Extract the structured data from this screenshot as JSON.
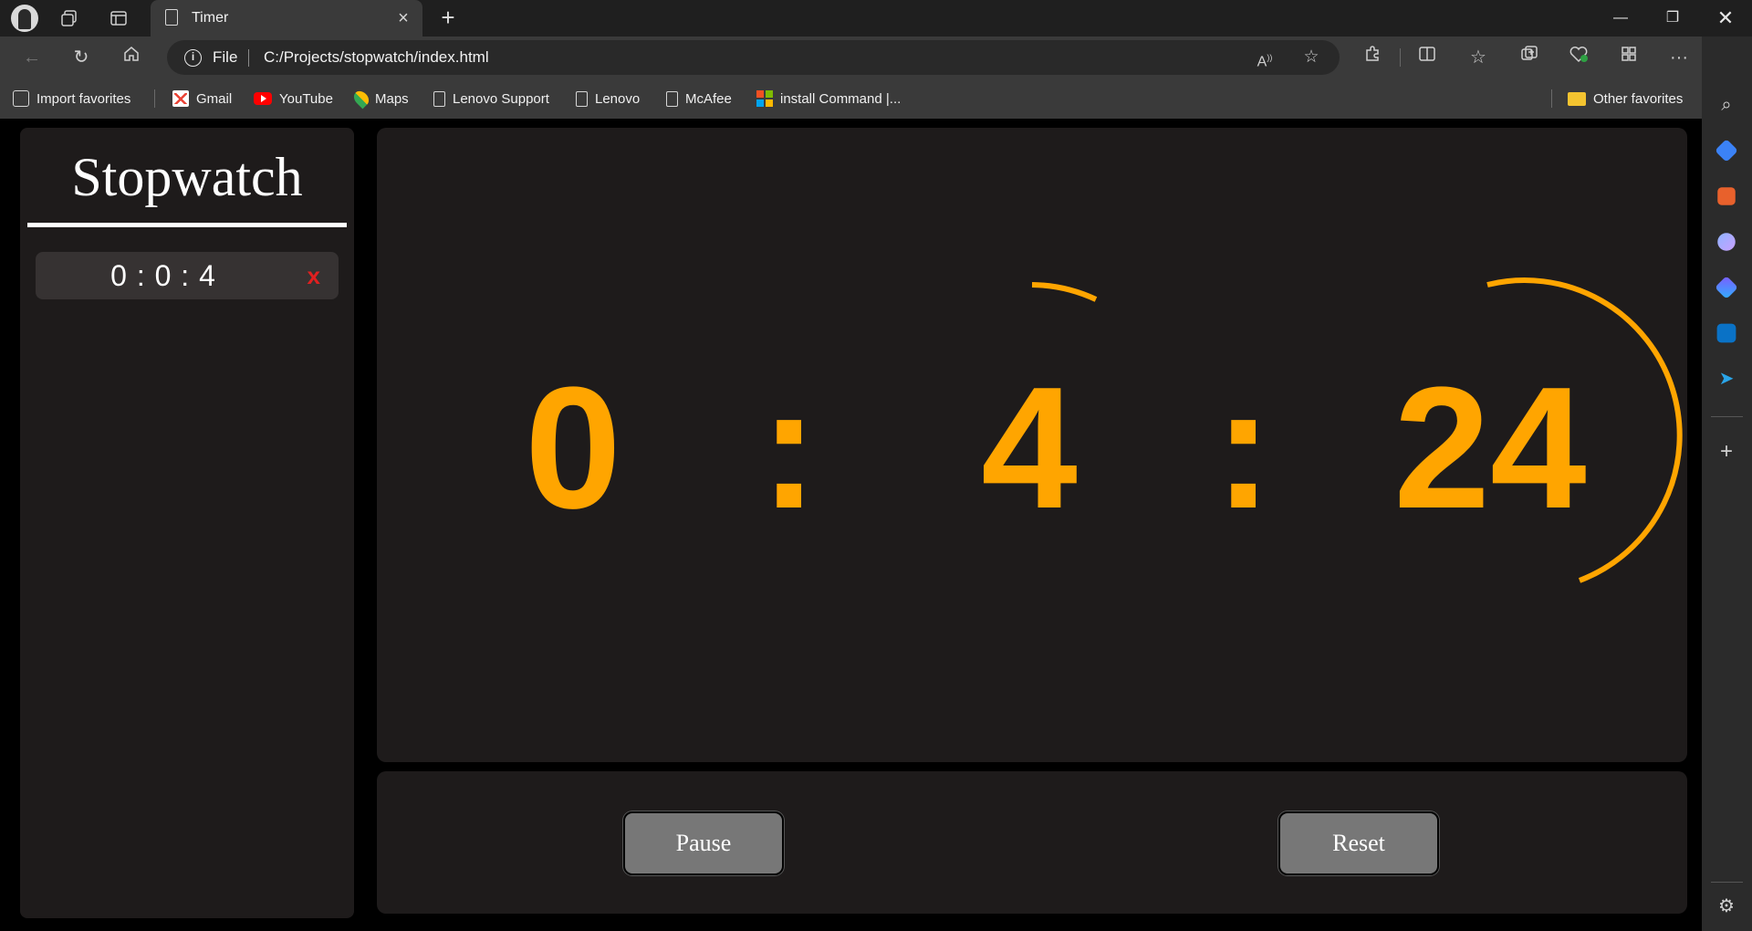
{
  "browser": {
    "tab_title": "Timer",
    "address_scheme": "File",
    "url": "C:/Projects/stopwatch/index.html"
  },
  "favorites": [
    {
      "label": "Import favorites",
      "icon": "import-icon"
    },
    {
      "label": "Gmail",
      "icon": "gmail-icon"
    },
    {
      "label": "YouTube",
      "icon": "youtube-icon"
    },
    {
      "label": "Maps",
      "icon": "maps-icon"
    },
    {
      "label": "Lenovo Support",
      "icon": "document-icon"
    },
    {
      "label": "Lenovo",
      "icon": "document-icon"
    },
    {
      "label": "McAfee",
      "icon": "document-icon"
    },
    {
      "label": "install Command |...",
      "icon": "microsoft-icon"
    }
  ],
  "other_favorites": "Other favorites",
  "app": {
    "title": "Stopwatch",
    "laps": [
      {
        "time": "0 : 0 : 4",
        "delete_label": "x"
      }
    ],
    "display": {
      "hours": "0",
      "sep1": ":",
      "minutes": "4",
      "sep2": ":",
      "seconds": "24"
    },
    "controls": {
      "pause_label": "Pause",
      "reset_label": "Reset"
    }
  },
  "colors": {
    "accent": "#ffa500",
    "panel": "#1e1b1b",
    "delete": "#e02020"
  }
}
